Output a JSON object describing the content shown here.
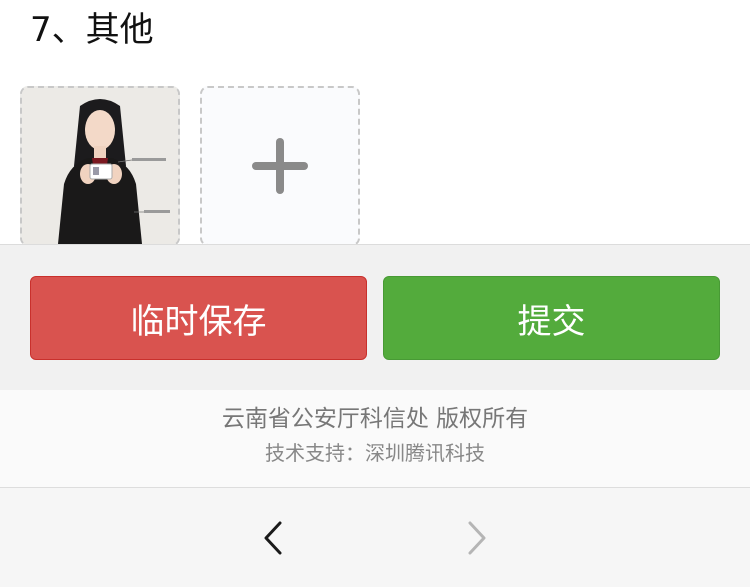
{
  "section": {
    "title": "7、其他"
  },
  "photos": {
    "add_icon": "plus-icon"
  },
  "actions": {
    "save_label": "临时保存",
    "submit_label": "提交",
    "save_color": "#d9534f",
    "submit_color": "#53ab3c"
  },
  "footer": {
    "copyright": "云南省公安厅科信处 版权所有",
    "support": "技术支持：深圳腾讯科技"
  },
  "nav": {
    "back_icon": "chevron-left-icon",
    "forward_icon": "chevron-right-icon",
    "forward_enabled": false
  }
}
